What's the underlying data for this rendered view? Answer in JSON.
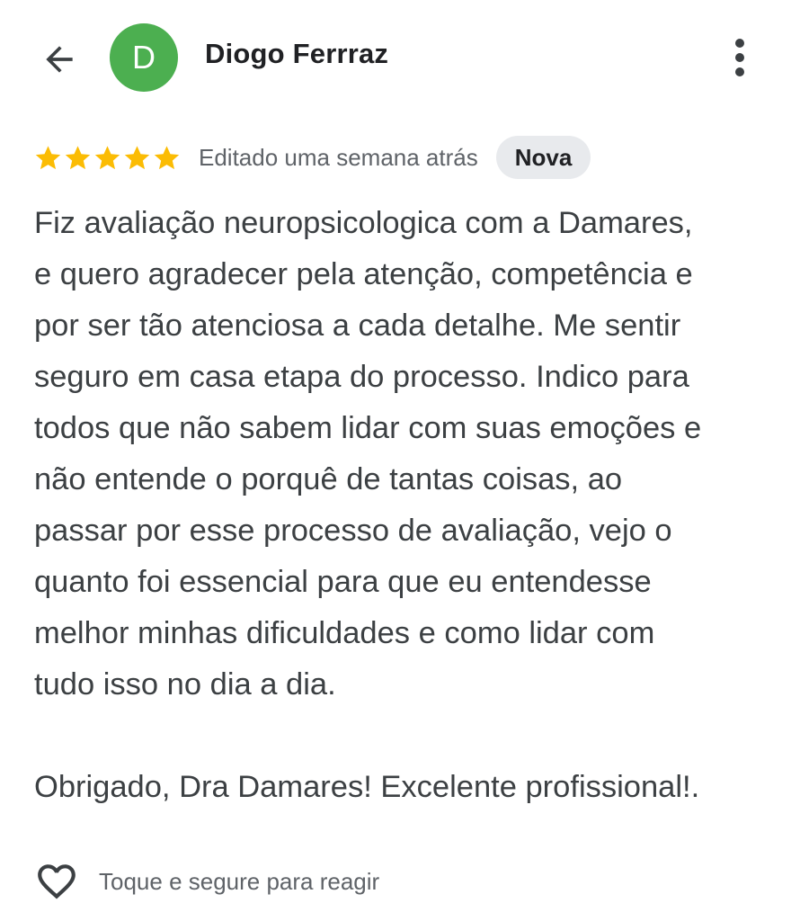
{
  "header": {
    "back_icon": "arrow-back-icon",
    "avatar_letter": "D",
    "avatar_color": "#4caf50",
    "author": "Diogo Ferrraz",
    "menu_icon": "more-vert-icon"
  },
  "review": {
    "rating": 5,
    "max_rating": 5,
    "star_color": "#fbbc04",
    "edited_label": "Editado uma semana atrás",
    "badge": "Nova",
    "badge_bg": "#e8eaed",
    "lines": [
      "Fiz avaliação neuropsicologica com a Damares,",
      "e quero agradecer pela atenção, competência e",
      "por ser tão atenciosa a cada detalhe. Me sentir",
      "seguro em casa etapa do processo. Indico para",
      "todos que não sabem lidar com suas emoções e",
      "não entende o porquê de tantas coisas, ao",
      "passar por esse processo de avaliação, vejo o",
      "quanto foi essencial para que eu entendesse",
      "melhor minhas dificuldades e como lidar com",
      "tudo isso no dia a dia."
    ],
    "closing": "Obrigado, Dra Damares! Excelente profissional!."
  },
  "reaction": {
    "icon": "heart-outline-icon",
    "label": "Toque e segure para reagir"
  }
}
